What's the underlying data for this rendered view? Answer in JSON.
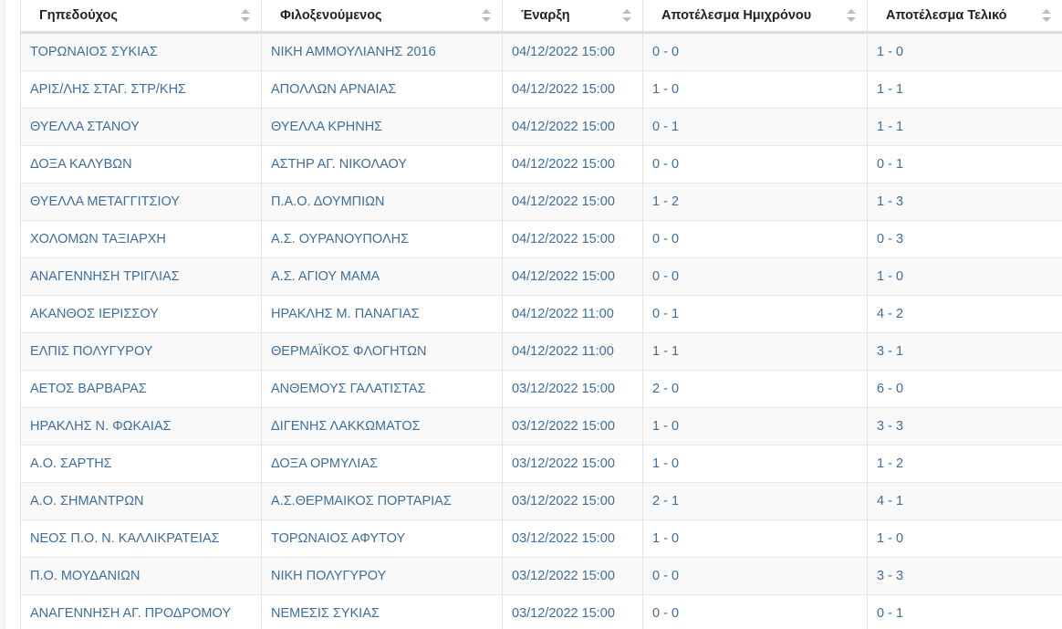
{
  "table": {
    "headers": [
      {
        "label": "Γηπεδούχος"
      },
      {
        "label": "Φιλοξενούμενος"
      },
      {
        "label": "Έναρξη"
      },
      {
        "label": "Αποτέλεσμα Ημιχρόνου"
      },
      {
        "label": "Αποτέλεσμα Τελικό"
      }
    ],
    "rows": [
      [
        "ΤΟΡΩΝΑΙΟΣ ΣΥΚΙΑΣ",
        "ΝΙΚΗ ΑΜΜΟΥΛΙΑΝΗΣ 2016",
        "04/12/2022 15:00",
        "0 - 0",
        "1 - 0"
      ],
      [
        "ΑΡΙΣ/ΛΗΣ ΣΤΑΓ. ΣΤΡ/ΚΗΣ",
        "ΑΠΟΛΛΩΝ ΑΡΝΑΙΑΣ",
        "04/12/2022 15:00",
        "1 - 0",
        "1 - 1"
      ],
      [
        "ΘΥΕΛΛΑ ΣΤΑΝΟΥ",
        "ΘΥΕΛΛΑ ΚΡΗΝΗΣ",
        "04/12/2022 15:00",
        "0 - 1",
        "1 - 1"
      ],
      [
        "ΔΟΞΑ ΚΑΛΥΒΩΝ",
        "ΑΣΤΗΡ ΑΓ. ΝΙΚΟΛΑΟΥ",
        "04/12/2022 15:00",
        "0 - 0",
        "0 - 1"
      ],
      [
        "ΘΥΕΛΛΑ ΜΕΤΑΓΓΙΤΣΙΟΥ",
        "Π.Α.Ο. ΔΟΥΜΠΙΩΝ",
        "04/12/2022 15:00",
        "1 - 2",
        "1 - 3"
      ],
      [
        "ΧΟΛΟΜΩΝ ΤΑΞΙΑΡΧΗ",
        "Α.Σ. ΟΥΡΑΝΟΥΠΟΛΗΣ",
        "04/12/2022 15:00",
        "0 - 0",
        "0 - 3"
      ],
      [
        "ΑΝΑΓΕΝΝΗΣΗ ΤΡΙΓΛΙΑΣ",
        "Α.Σ. ΑΓΙΟΥ ΜΑΜΑ",
        "04/12/2022 15:00",
        "0 - 0",
        "1 - 0"
      ],
      [
        "ΑΚΑΝΘΟΣ ΙΕΡΙΣΣΟΥ",
        "ΗΡΑΚΛΗΣ Μ. ΠΑΝΑΓΙΑΣ",
        "04/12/2022 11:00",
        "0 - 1",
        "4 - 2"
      ],
      [
        "ΕΛΠΙΣ ΠΟΛΥΓΥΡΟΥ",
        "ΘΕΡΜΑΪΚΟΣ ΦΛΟΓΗΤΩΝ",
        "04/12/2022 11:00",
        "1 - 1",
        "3 - 1"
      ],
      [
        "ΑΕΤΟΣ ΒΑΡΒΑΡΑΣ",
        "ΑΝΘΕΜΟΥΣ ΓΑΛΑΤΙΣΤΑΣ",
        "03/12/2022 15:00",
        "2 - 0",
        "6 - 0"
      ],
      [
        "ΗΡΑΚΛΗΣ Ν. ΦΩΚΑΙΑΣ",
        "ΔΙΓΕΝΗΣ ΛΑΚΚΩΜΑΤΟΣ",
        "03/12/2022 15:00",
        "1 - 0",
        "3 - 3"
      ],
      [
        "Α.Ο. ΣΑΡΤΗΣ",
        "ΔΟΞΑ ΟΡΜΥΛΙΑΣ",
        "03/12/2022 15:00",
        "1 - 0",
        "1 - 2"
      ],
      [
        "Α.Ο. ΣΗΜΑΝΤΡΩΝ",
        "Α.Σ.ΘΕΡΜΑΙΚΟΣ ΠΟΡΤΑΡΙΑΣ",
        "03/12/2022 15:00",
        "2 - 1",
        "4 - 1"
      ],
      [
        "ΝΕΟΣ Π.Ο. Ν. ΚΑΛΛΙΚΡΑΤΕΙΑΣ",
        "ΤΟΡΩΝΑΙΟΣ ΑΦΥΤΟΥ",
        "03/12/2022 15:00",
        "1 - 0",
        "1 - 0"
      ],
      [
        "Π.Ο. ΜΟΥΔΑΝΙΩΝ",
        "ΝΙΚΗ ΠΟΛΥΓΥΡΟΥ",
        "03/12/2022 15:00",
        "0 - 0",
        "3 - 3"
      ],
      [
        "ΑΝΑΓΕΝΝΗΣΗ ΑΓ. ΠΡΟΔΡΟΜΟΥ",
        "ΝΕΜΕΣΙΣ ΣΥΚΙΑΣ",
        "03/12/2022 15:00",
        "0 - 0",
        "0 - 1"
      ]
    ]
  }
}
